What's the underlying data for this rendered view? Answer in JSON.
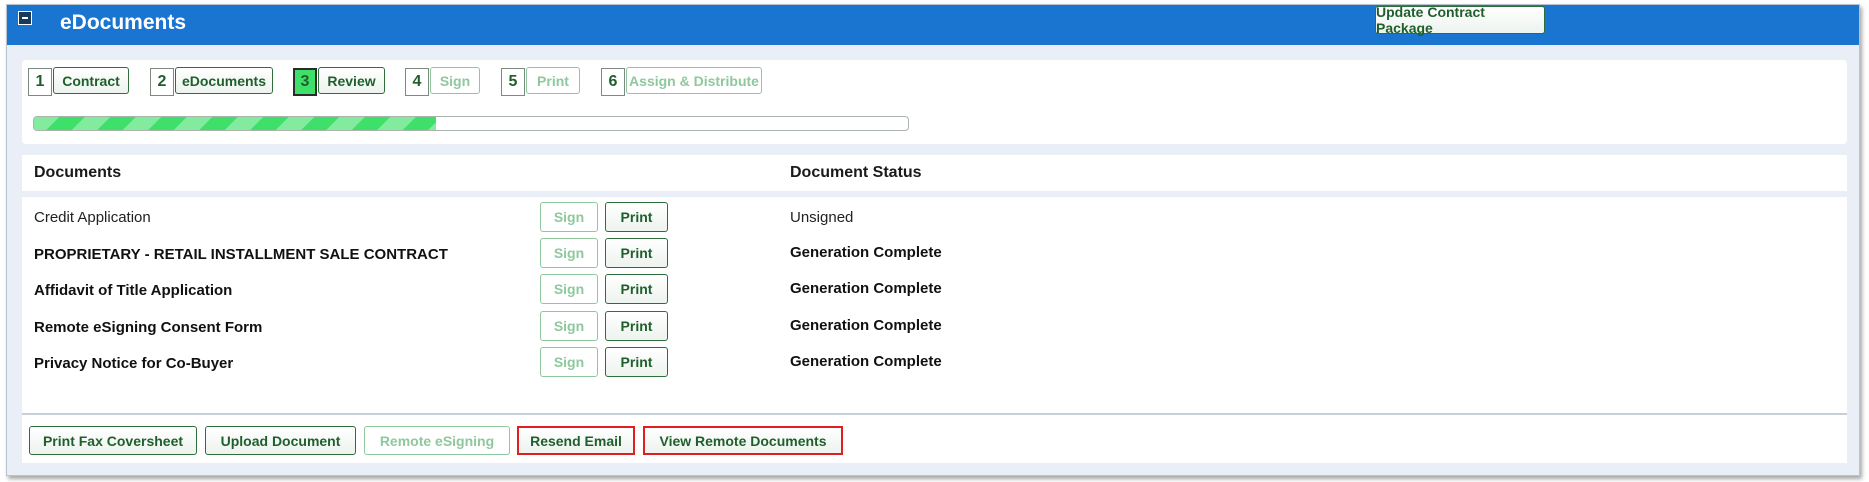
{
  "header": {
    "title": "eDocuments",
    "update_button": "Update Contract Package"
  },
  "steps": [
    {
      "number": "1",
      "label": "Contract",
      "state": "done"
    },
    {
      "number": "2",
      "label": "eDocuments",
      "state": "done"
    },
    {
      "number": "3",
      "label": "Review",
      "state": "current"
    },
    {
      "number": "4",
      "label": "Sign",
      "state": "disabled"
    },
    {
      "number": "5",
      "label": "Print",
      "state": "disabled"
    },
    {
      "number": "6",
      "label": "Assign & Distribute",
      "state": "disabled"
    }
  ],
  "progress": {
    "fraction": 0.46
  },
  "table": {
    "col_documents": "Documents",
    "col_status": "Document Status",
    "rows": [
      {
        "name": "Credit Application",
        "sign": "Sign",
        "print": "Print",
        "status": "Unsigned",
        "bold": false
      },
      {
        "name": "PROPRIETARY - RETAIL INSTALLMENT SALE CONTRACT",
        "sign": "Sign",
        "print": "Print",
        "status": "Generation Complete",
        "bold": true
      },
      {
        "name": "Affidavit of Title Application",
        "sign": "Sign",
        "print": "Print",
        "status": "Generation Complete",
        "bold": true
      },
      {
        "name": "Remote eSigning Consent Form",
        "sign": "Sign",
        "print": "Print",
        "status": "Generation Complete",
        "bold": true
      },
      {
        "name": "Privacy Notice for Co-Buyer",
        "sign": "Sign",
        "print": "Print",
        "status": "Generation Complete",
        "bold": true
      }
    ]
  },
  "footer": {
    "print_fax": "Print Fax Coversheet",
    "upload": "Upload Document",
    "remote_esigning": "Remote eSigning",
    "resend_email": "Resend Email",
    "view_remote": "View Remote Documents"
  },
  "colors": {
    "titlebar": "#1a75d0",
    "accent_green": "#1f5f2c",
    "current_step": "#3fe06a",
    "disabled_green": "#8fc89d",
    "highlight_red": "#e02020"
  }
}
